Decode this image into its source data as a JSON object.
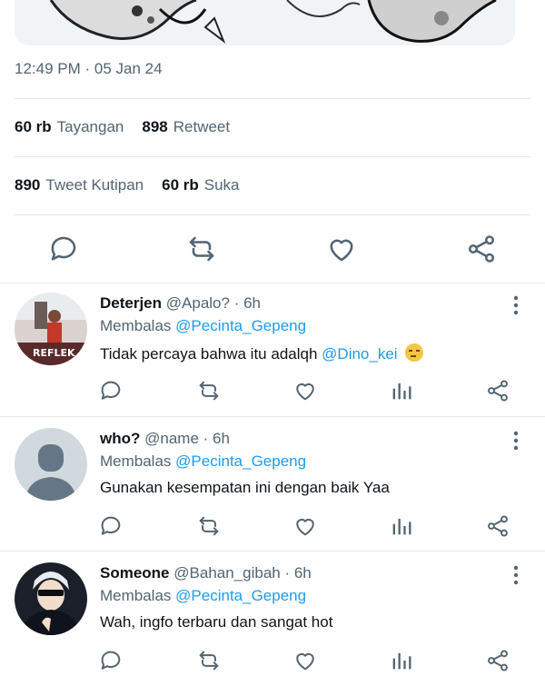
{
  "tweet": {
    "timestamp": "12:49 PM · 05 Jan 24",
    "views_count": "60 rb",
    "views_label": "Tayangan",
    "retweets_count": "898",
    "retweets_label": "Retweet",
    "quotes_count": "890",
    "quotes_label": "Tweet Kutipan",
    "likes_count": "60 rb",
    "likes_label": "Suka"
  },
  "replies": [
    {
      "name": "Deterjen",
      "handle": "@Apalo?",
      "time": "· 6h",
      "replying_prefix": "Membalas",
      "replying_to": "@Pecinta_Gepeng",
      "text": "Tidak percaya bahwa itu adalqh",
      "mention": "@Dino_kei",
      "avatar_caption": "REFLEK"
    },
    {
      "name": "who?",
      "handle": "@name",
      "time": "· 6h",
      "replying_prefix": "Membalas",
      "replying_to": "@Pecinta_Gepeng",
      "text": "Gunakan kesempatan ini dengan baik Yaa"
    },
    {
      "name": "Someone",
      "handle": "@Bahan_gibah",
      "time": "· 6h",
      "replying_prefix": "Membalas",
      "replying_to": "@Pecinta_Gepeng",
      "text": "Wah, ingfo terbaru dan sangat hot"
    }
  ],
  "colors": {
    "accent": "#1d9bf0",
    "text_primary": "#0f1419",
    "text_secondary": "#536471",
    "divider": "#e6e9ec"
  },
  "icons": [
    "reply-icon",
    "retweet-icon",
    "like-icon",
    "share-icon",
    "analytics-icon",
    "more-options-icon"
  ]
}
